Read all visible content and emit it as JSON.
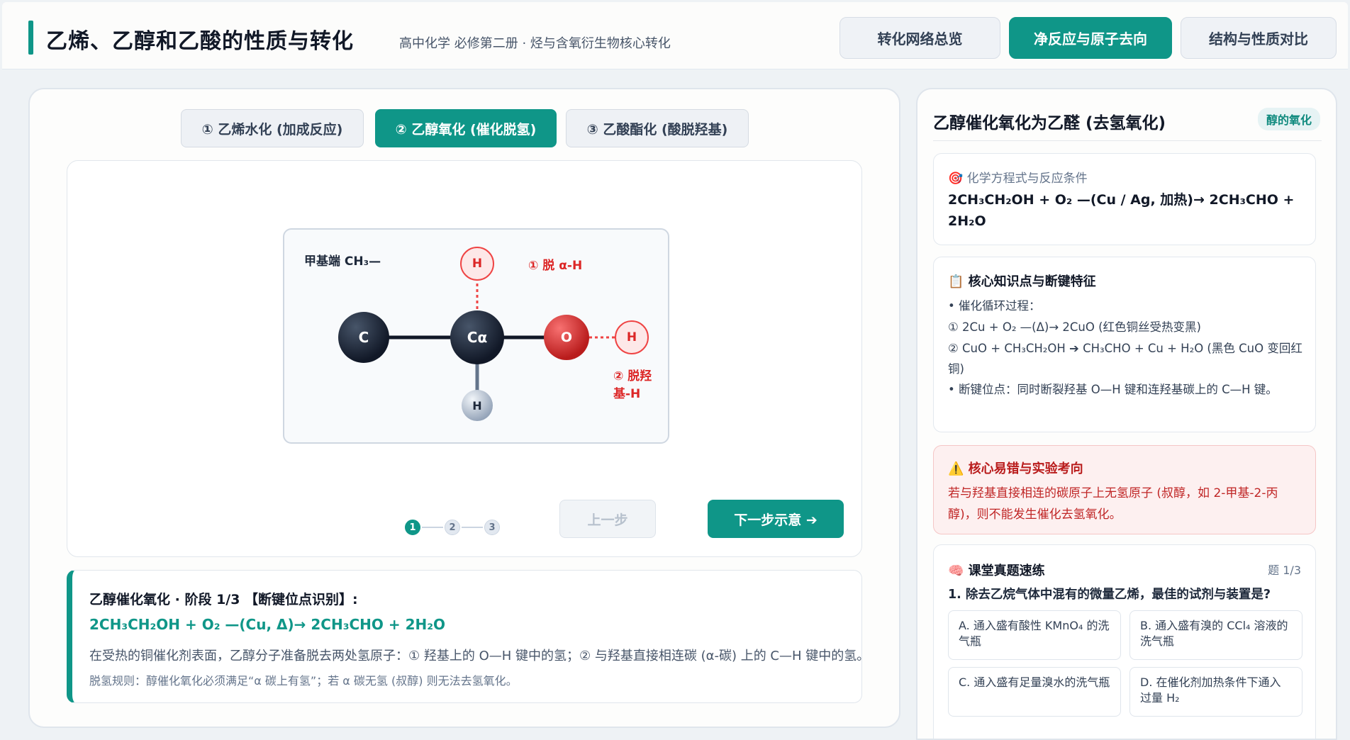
{
  "header": {
    "title": "乙烯、乙醇和乙酸的性质与转化",
    "subtitle": "高中化学 必修第二册 · 烃与含氧衍生物核心转化",
    "nav": [
      {
        "label": "转化网络总览"
      },
      {
        "label": "净反应与原子去向"
      },
      {
        "label": "结构与性质对比"
      }
    ]
  },
  "tabs": [
    {
      "label": "① 乙烯水化 (加成反应)"
    },
    {
      "label": "② 乙醇氧化 (催化脱氢)"
    },
    {
      "label": "③ 乙酸酯化 (酸脱羟基)"
    }
  ],
  "molecule": {
    "corner_label": "甲基端 CH₃—",
    "atoms": {
      "c": "C",
      "ca": "Cα",
      "o": "O",
      "h_top": "H",
      "h_oh": "H",
      "h_bottom": "H"
    },
    "label_alpha": "① 脱 α-H",
    "label_hydroxyl": "② 脱羟基-H"
  },
  "pager": {
    "steps": [
      "1",
      "2",
      "3"
    ],
    "active": 1
  },
  "controls": {
    "prev": "上一步",
    "next": "下一步示意 ➔"
  },
  "explain": {
    "heading": "乙醇催化氧化 · 阶段 1/3 【断键位点识别】:",
    "equation": "2CH₃CH₂OH + O₂ —(Cu, Δ)→ 2CH₃CHO + 2H₂O",
    "body": "在受热的铜催化剂表面，乙醇分子准备脱去两处氢原子：① 羟基上的 O—H 键中的氢；② 与羟基直接相连碳 (α-碳) 上的 C—H 键中的氢。",
    "rule": "脱氢规则：醇催化氧化必须满足“α 碳上有氢”；若 α 碳无氢 (叔醇) 则无法去氢氧化。"
  },
  "right": {
    "title": "乙醇催化氧化为乙醛 (去氢氧化)",
    "badge": "醇的氧化",
    "equation_card": {
      "heading": "🎯 化学方程式与反应条件",
      "equation": "2CH₃CH₂OH + O₂ —(Cu / Ag, 加热)→ 2CH₃CHO + 2H₂O"
    },
    "knowledge": {
      "heading": "📋 核心知识点与断键特征",
      "lines": [
        "• 催化循环过程：",
        "① 2Cu + O₂ —(Δ)→ 2CuO (红色铜丝受热变黑)",
        "② CuO + CH₃CH₂OH ➔ CH₃CHO + Cu + H₂O (黑色 CuO 变回红铜)",
        "• 断键位点：同时断裂羟基 O—H 键和连羟基碳上的 C—H 键。"
      ]
    },
    "warning": {
      "heading": "⚠️ 核心易错与实验考向",
      "body": "若与羟基直接相连的碳原子上无氢原子 (叔醇，如 2-甲基-2-丙醇)，则不能发生催化去氢氧化。"
    },
    "quiz": {
      "heading": "🧠 课堂真题速练",
      "counter": "题 1/3",
      "question": "1. 除去乙烷气体中混有的微量乙烯，最佳的试剂与装置是?",
      "options": [
        "A. 通入盛有酸性 KMnO₄ 的洗气瓶",
        "B. 通入盛有溴的 CCl₄ 溶液的洗气瓶",
        "C. 通入盛有足量溴水的洗气瓶",
        "D. 在催化剂加热条件下通入过量 H₂"
      ]
    }
  },
  "colors": {
    "accent": "#0f9688",
    "carbon": "#1f2937",
    "oxygen": "#dc2626",
    "warn_text": "#dc2626"
  }
}
